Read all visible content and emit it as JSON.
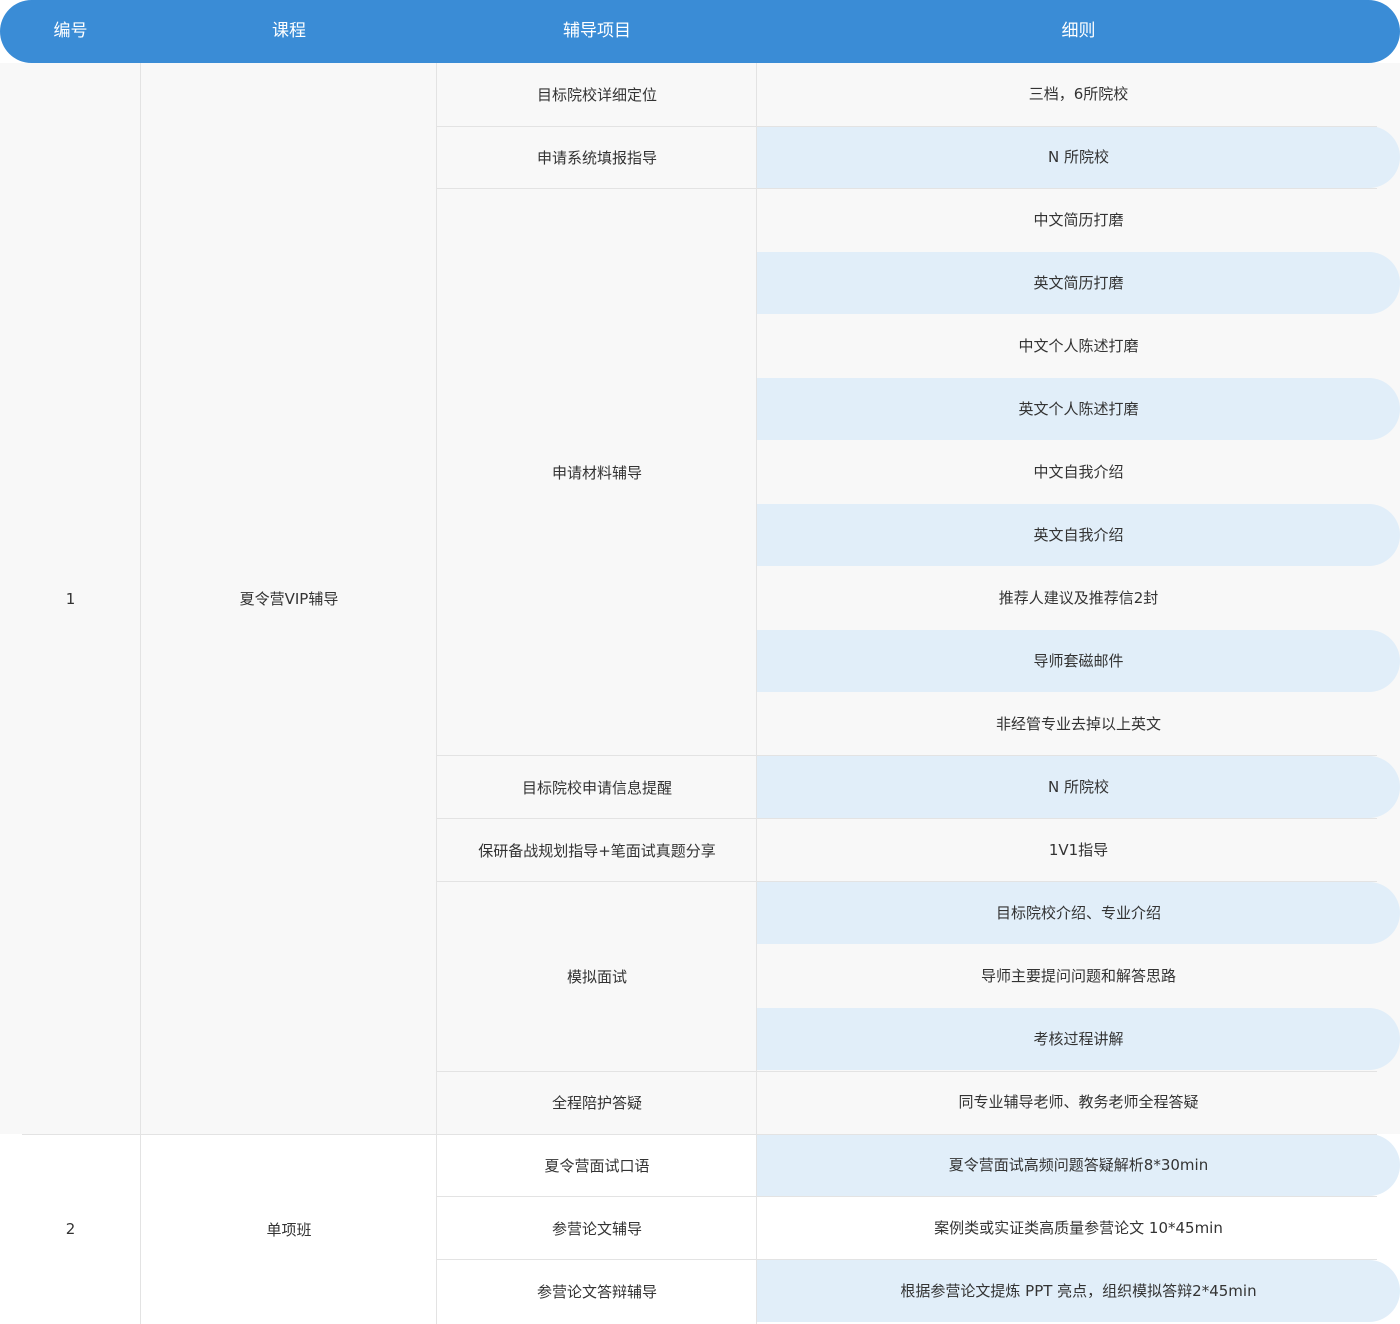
{
  "header": {
    "col_no": "编号",
    "col_course": "课程",
    "col_item": "辅导项目",
    "col_detail": "细则"
  },
  "colors": {
    "header_bg": "#3a8cd6",
    "pill_bg": "#e1eef9",
    "group1_bg": "#f8f8f8"
  },
  "groups": [
    {
      "no": "1",
      "course": "夏令营VIP辅导"
    },
    {
      "no": "2",
      "course": "单项班"
    }
  ],
  "items": [
    "目标院校详细定位",
    "申请系统填报指导",
    "申请材料辅导",
    "目标院校申请信息提醒",
    "保研备战规划指导+笔面试真题分享",
    "模拟面试",
    "全程陪护答疑",
    "夏令营面试口语",
    "参营论文辅导",
    "参营论文答辩辅导"
  ],
  "details": [
    "三档，6所院校",
    "N 所院校",
    "中文简历打磨",
    "英文简历打磨",
    "中文个人陈述打磨",
    "英文个人陈述打磨",
    "中文自我介绍",
    "英文自我介绍",
    "推荐人建议及推荐信2封",
    "导师套磁邮件",
    "非经管专业去掉以上英文",
    "N 所院校",
    "1V1指导",
    "目标院校介绍、专业介绍",
    "导师主要提问问题和解答思路",
    "考核过程讲解",
    "同专业辅导老师、教务老师全程答疑",
    "夏令营面试高频问题答疑解析8*30min",
    "案例类或实证类高质量参营论文 10*45min",
    "根据参营论文提炼 PPT 亮点，组织模拟答辩2*45min"
  ]
}
